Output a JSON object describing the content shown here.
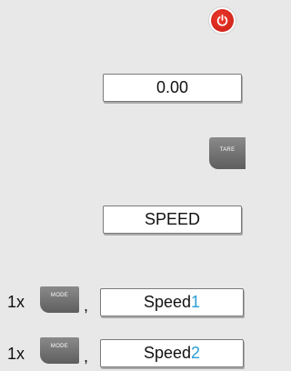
{
  "power": {
    "icon": "power-icon",
    "color": "#d9251c"
  },
  "display": {
    "value": "0.00"
  },
  "keys": {
    "tare": "TARE",
    "mode": "MODE"
  },
  "mode_display": "SPEED",
  "steps": [
    {
      "count": "1x",
      "separator": ",",
      "result_text": "Speed",
      "result_num": "1"
    },
    {
      "count": "1x",
      "separator": ",",
      "result_text": "Speed",
      "result_num": "2"
    }
  ],
  "colors": {
    "accent": "#2a9fd6",
    "key": "#6e6e6e"
  }
}
